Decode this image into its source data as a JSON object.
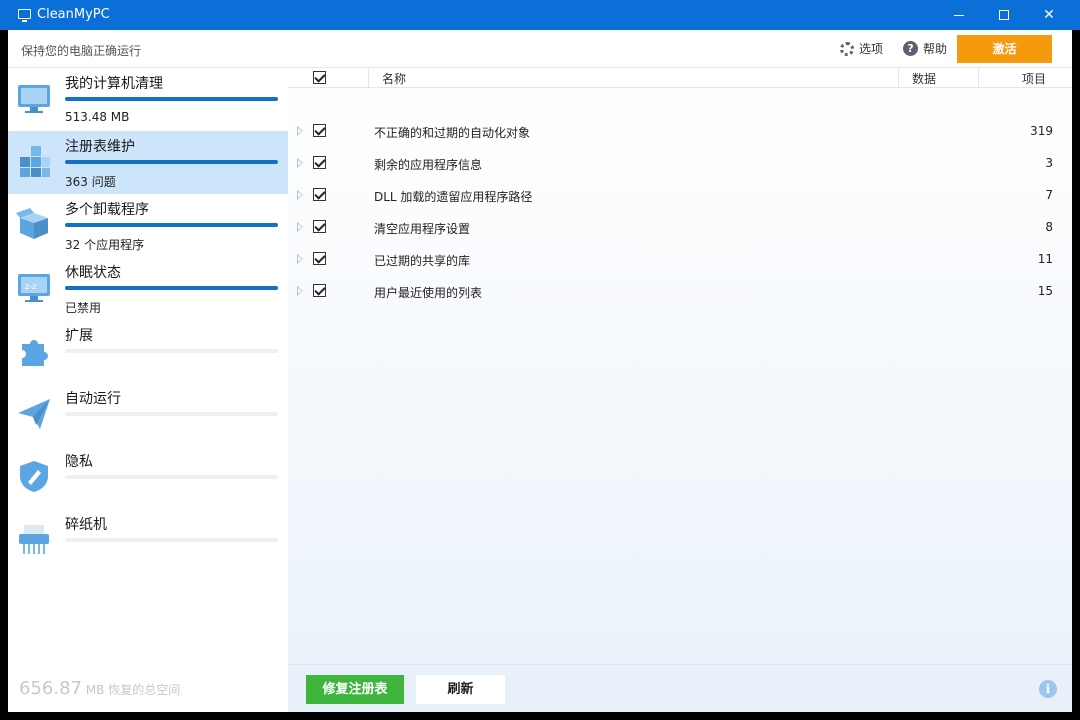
{
  "window": {
    "title": "CleanMyPC"
  },
  "header": {
    "tagline": "保持您的电脑正确运行",
    "options_label": "选项",
    "help_label": "帮助",
    "activate_label": "激活"
  },
  "sidebar": {
    "items": [
      {
        "label": "我的计算机清理",
        "sub": "513.48 MB",
        "progress": 1.0,
        "icon": "monitor-icon"
      },
      {
        "label": "注册表维护",
        "sub": "363 问题",
        "progress": 1.0,
        "icon": "registry-cubes-icon"
      },
      {
        "label": "多个卸载程序",
        "sub": "32 个应用程序",
        "progress": 1.0,
        "icon": "box-icon"
      },
      {
        "label": "休眠状态",
        "sub": "已禁用",
        "progress": 1.0,
        "icon": "sleep-monitor-icon"
      },
      {
        "label": "扩展",
        "sub": "",
        "progress": 0.0,
        "icon": "puzzle-icon"
      },
      {
        "label": "自动运行",
        "sub": "",
        "progress": 0.0,
        "icon": "paper-plane-icon"
      },
      {
        "label": "隐私",
        "sub": "",
        "progress": 0.0,
        "icon": "shield-broom-icon"
      },
      {
        "label": "碎纸机",
        "sub": "",
        "progress": 0.0,
        "icon": "shredder-icon"
      }
    ],
    "active_index": 1,
    "footer_value": "656.87",
    "footer_unit": "MB",
    "footer_text": "恢复的总空间"
  },
  "table": {
    "col_name": "名称",
    "col_data": "数据",
    "col_items": "项目",
    "rows": [
      {
        "name": "不正确的和过期的自动化对象",
        "count": "319"
      },
      {
        "name": "剩余的应用程序信息",
        "count": "3"
      },
      {
        "name": "DLL 加载的遗留应用程序路径",
        "count": "7"
      },
      {
        "name": "清空应用程序设置",
        "count": "8"
      },
      {
        "name": "已过期的共享的库",
        "count": "11"
      },
      {
        "name": "用户最近使用的列表",
        "count": "15"
      }
    ]
  },
  "footer": {
    "fix_label": "修复注册表",
    "refresh_label": "刷新"
  },
  "colors": {
    "titlebar": "#0a6fd6",
    "accent": "#1470c6",
    "activate": "#f59a0c",
    "fix_button": "#3fb53d",
    "active_nav": "#cde5fb"
  }
}
